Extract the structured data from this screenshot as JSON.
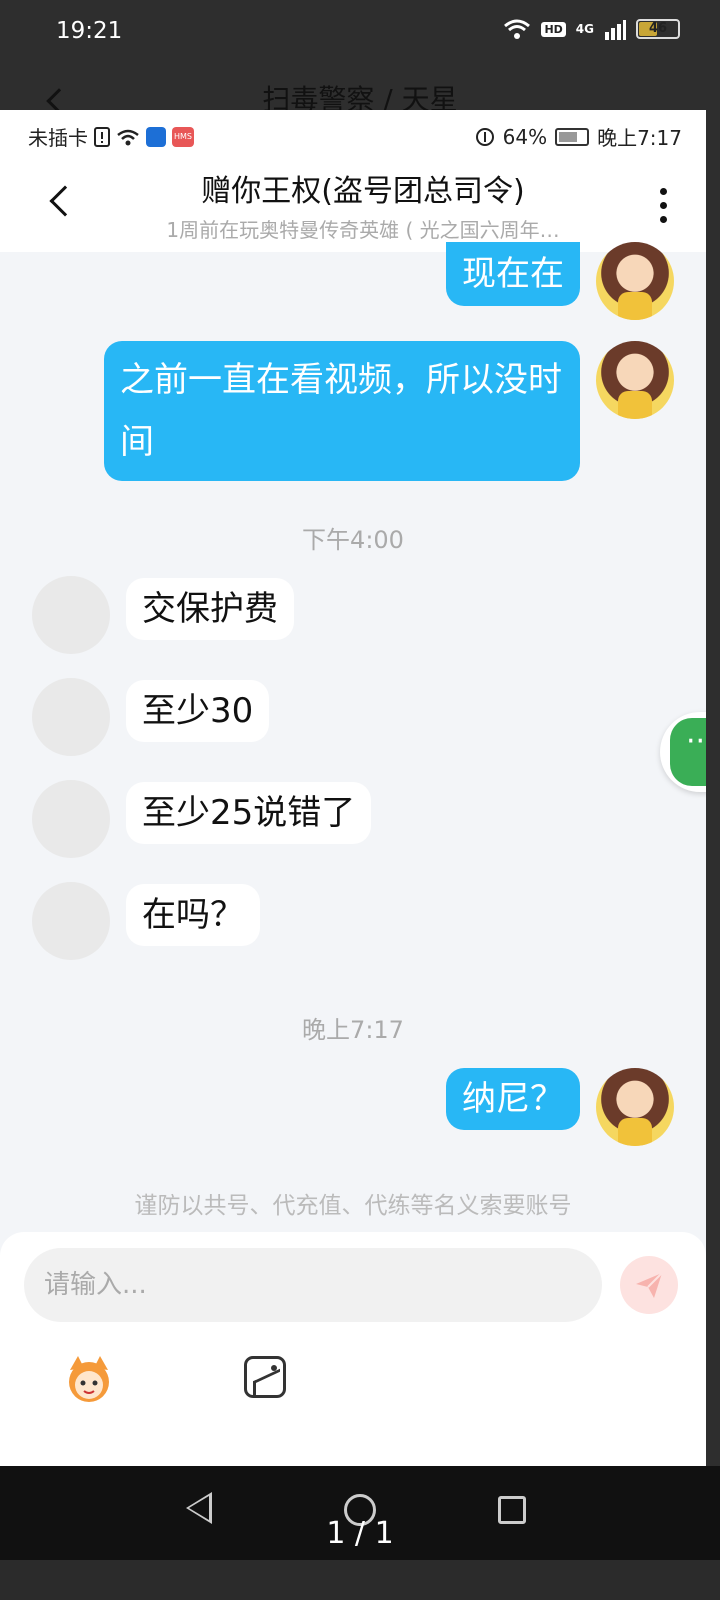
{
  "outer": {
    "time": "19:21",
    "title": "扫毒警察 / 天星",
    "battery": "46",
    "network": "4G",
    "hd": "HD"
  },
  "inner_status": {
    "sim": "未插卡",
    "hms": "HMS",
    "battery_percent": "64%",
    "time": "晚上7:17"
  },
  "chat": {
    "title": "赠你王权(盗号团总司令)",
    "subtitle": "1周前在玩奥特曼传奇英雄 ( 光之国六周年…"
  },
  "messages": [
    {
      "id": "m1",
      "side": "out",
      "text": "现在在"
    },
    {
      "id": "m2",
      "side": "out",
      "text": "之前一直在看视频，所以没时间"
    },
    {
      "id": "t1",
      "timestamp": "下午4:00"
    },
    {
      "id": "m3",
      "side": "in",
      "text": "交保护费"
    },
    {
      "id": "m4",
      "side": "in",
      "text": "至少30"
    },
    {
      "id": "m5",
      "side": "in",
      "text": "至少25说错了"
    },
    {
      "id": "m6",
      "side": "in",
      "text": "在吗？"
    },
    {
      "id": "t2",
      "timestamp": "晚上7:17"
    },
    {
      "id": "m7",
      "side": "out",
      "text": "纳尼？"
    }
  ],
  "notice": "谨防以共号、代充值、代练等名义索要账号",
  "input": {
    "placeholder": "请输入..."
  },
  "pager": "1 / 1",
  "colors": {
    "outgoing_bubble": "#28b7f5",
    "incoming_bubble": "#ffffff",
    "background": "#f3f5f8"
  }
}
